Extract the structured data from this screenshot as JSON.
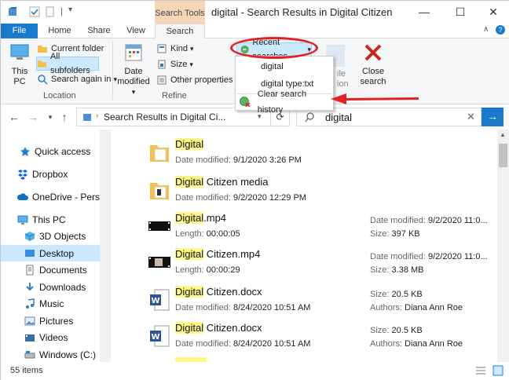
{
  "window": {
    "title": "digital - Search Results in Digital Citizen",
    "context_tab": "Search Tools",
    "controls": {
      "minimize": "—",
      "maximize": "☐",
      "close": "✕"
    }
  },
  "ribbon_tabs": [
    "File",
    "Home",
    "Share",
    "View",
    "Search"
  ],
  "ribbon": {
    "this_pc": "This PC",
    "current_folder": "Current folder",
    "all_subfolders": "All subfolders",
    "search_again_in": "Search again in",
    "location_label": "Location",
    "date_modified": "Date modified",
    "kind": "Kind",
    "size": "Size",
    "other_properties": "Other properties",
    "refine_label": "Refine",
    "recent_searches": "Recent searches",
    "close_search": "Close search",
    "partial_label_1": "ile",
    "partial_label_2": "ion"
  },
  "dropdown": {
    "items": [
      "digital",
      "digital type:txt"
    ],
    "clear": "Clear search history"
  },
  "address": {
    "path": "Search Results in Digital Ci...",
    "search_value": "digital"
  },
  "nav": [
    {
      "label": "Quick access",
      "icon": "star-icon"
    },
    {
      "label": "Dropbox",
      "icon": "dropbox-icon"
    },
    {
      "label": "OneDrive - Person",
      "icon": "cloud-icon"
    },
    {
      "label": "This PC",
      "icon": "computer-icon"
    },
    {
      "label": "3D Objects",
      "icon": "cube-icon"
    },
    {
      "label": "Desktop",
      "icon": "desktop-icon"
    },
    {
      "label": "Documents",
      "icon": "document-icon"
    },
    {
      "label": "Downloads",
      "icon": "download-icon"
    },
    {
      "label": "Music",
      "icon": "music-icon"
    },
    {
      "label": "Pictures",
      "icon": "picture-icon"
    },
    {
      "label": "Videos",
      "icon": "video-icon"
    },
    {
      "label": "Windows (C:)",
      "icon": "drive-icon"
    }
  ],
  "files": [
    {
      "hl": "Digital",
      "rest": "",
      "type": "folder",
      "meta_k": "Date modified:",
      "meta_v": "9/1/2020 3:26 PM"
    },
    {
      "hl": "Digital",
      "rest": " Citizen media",
      "type": "folder",
      "meta_k": "Date modified:",
      "meta_v": "9/2/2020 12:29 PM"
    },
    {
      "hl": "Digital",
      "rest": ".mp4",
      "type": "video",
      "meta_k": "Length:",
      "meta_v": "00:00:05",
      "side1_k": "Date modified:",
      "side1_v": "9/2/2020 11:0...",
      "side2_k": "Size:",
      "side2_v": "397 KB"
    },
    {
      "hl": "Digital",
      "rest": " Citizen.mp4",
      "type": "video",
      "meta_k": "Length:",
      "meta_v": "00:00:29",
      "side1_k": "Date modified:",
      "side1_v": "9/2/2020 11:0...",
      "side2_k": "Size:",
      "side2_v": "3.38 MB"
    },
    {
      "hl": "Digital",
      "rest": " Citizen.docx",
      "type": "word",
      "meta_k": "Date modified:",
      "meta_v": "8/24/2020 10:51 AM",
      "side1_k": "Size:",
      "side1_v": "20.5 KB",
      "side2_k": "Authors:",
      "side2_v": "Diana Ann Roe"
    },
    {
      "hl": "Digital",
      "rest": " Citizen.docx",
      "type": "word",
      "meta_k": "Date modified:",
      "meta_v": "8/24/2020 10:51 AM",
      "side1_k": "Size:",
      "side1_v": "20.5 KB",
      "side2_k": "Authors:",
      "side2_v": "Diana Ann Roe"
    }
  ],
  "status": {
    "items": "55 items"
  },
  "colors": {
    "accent": "#1979ca",
    "highlight": "#fef78a",
    "annotation": "#e32026",
    "context_tab": "#f6d6b6"
  }
}
